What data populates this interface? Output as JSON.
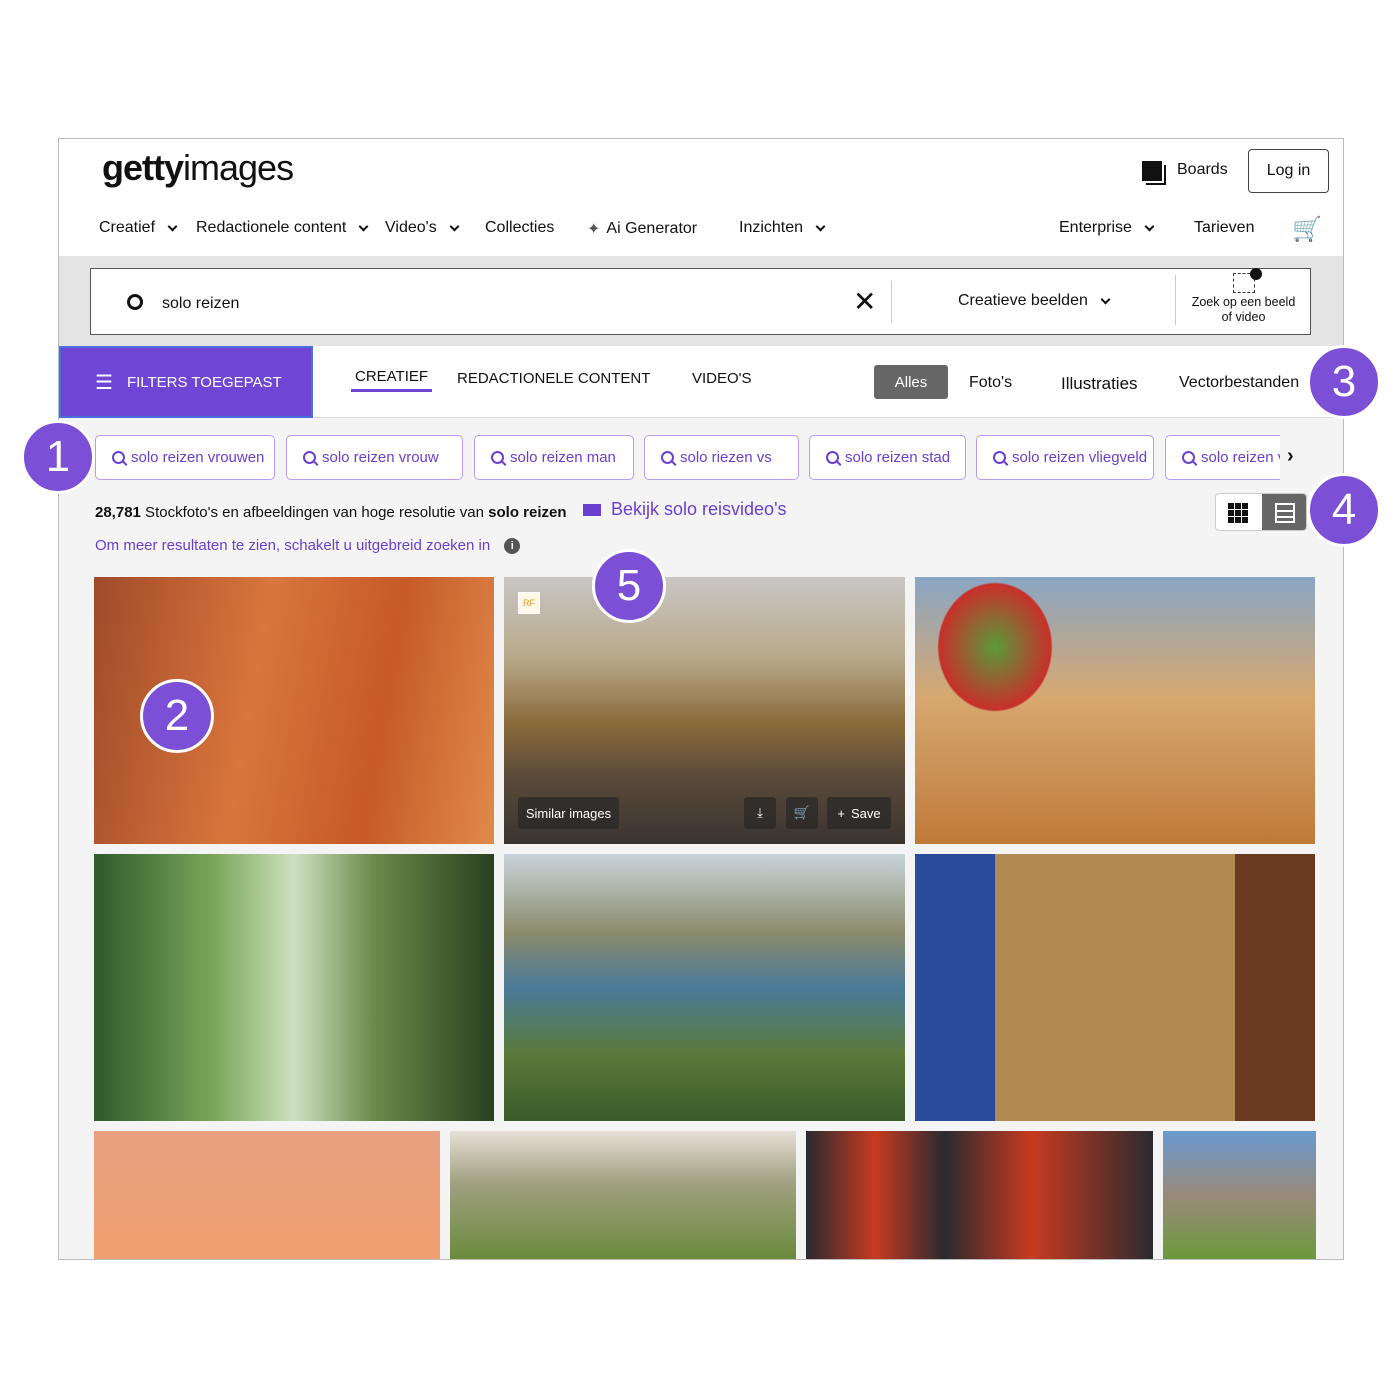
{
  "header": {
    "logo_bold": "getty",
    "logo_light": "images",
    "boards": "Boards",
    "login": "Log in"
  },
  "nav": {
    "items": [
      "Creatief",
      "Redactionele content",
      "Video's",
      "Collecties",
      "Ai Generator",
      "Inzichten"
    ],
    "enterprise": "Enterprise",
    "pricing": "Tarieven"
  },
  "search": {
    "value": "solo reizen",
    "type": "Creatieve beelden",
    "image_search": "Zoek op een beeld",
    "image_search2": "of video"
  },
  "filters": {
    "button": "FILTERS TOEGEPAST",
    "tabs": [
      "CREATIEF",
      "REDACTIONELE CONTENT",
      "VIDEO'S"
    ],
    "active_tab": "CREATIEF",
    "types": [
      "Alles",
      "Foto's",
      "Illustraties",
      "Vectorbestanden"
    ],
    "active_type": "Alles"
  },
  "chips": [
    "solo reizen vrouwen",
    "solo reizen vrouw",
    "solo reizen man",
    "solo riezen vs",
    "solo reizen stad",
    "solo reizen vliegveld",
    "solo reizen v"
  ],
  "results": {
    "count": "28,781",
    "text": " Stockfoto's en afbeeldingen van hoge resolutie van ",
    "query": "solo reizen",
    "video_link": "Bekijk solo reisvideo's",
    "expand_hint": "Om meer resultaten te zien, schakelt u uitgebreid zoeken in"
  },
  "overlay": {
    "similar": "Similar images",
    "save": "Save",
    "rf": "RF"
  },
  "badges": [
    "1",
    "2",
    "3",
    "4",
    "5"
  ],
  "colors": {
    "accent": "#6e45d4",
    "link": "#6a3fd0"
  }
}
